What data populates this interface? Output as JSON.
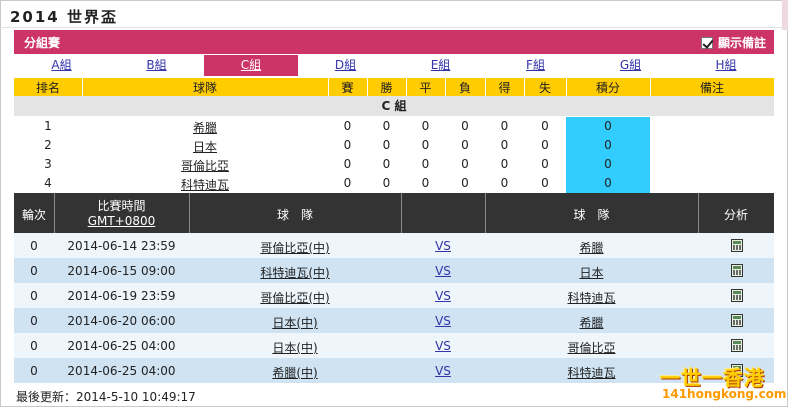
{
  "page_title": "2014 世界盃",
  "group_bar": {
    "label": "分組賽",
    "toggle_label": "顯示備註",
    "toggle_checked": true
  },
  "tabs": [
    "A組",
    "B組",
    "C組",
    "D組",
    "E組",
    "F組",
    "G組",
    "H組"
  ],
  "active_tab": "C組",
  "standings_header": {
    "rank": "排名",
    "team": "球隊",
    "played": "賽",
    "won": "勝",
    "draw": "平",
    "lost": "負",
    "gf": "得",
    "ga": "失",
    "points": "積分",
    "remarks": "備注"
  },
  "group_name": "C 組",
  "standings": [
    {
      "rank": "1",
      "team": "希臘",
      "played": "0",
      "won": "0",
      "draw": "0",
      "lost": "0",
      "gf": "0",
      "ga": "0",
      "points": "0"
    },
    {
      "rank": "2",
      "team": "日本",
      "played": "0",
      "won": "0",
      "draw": "0",
      "lost": "0",
      "gf": "0",
      "ga": "0",
      "points": "0"
    },
    {
      "rank": "3",
      "team": "哥倫比亞",
      "played": "0",
      "won": "0",
      "draw": "0",
      "lost": "0",
      "gf": "0",
      "ga": "0",
      "points": "0"
    },
    {
      "rank": "4",
      "team": "科特迪瓦",
      "played": "0",
      "won": "0",
      "draw": "0",
      "lost": "0",
      "gf": "0",
      "ga": "0",
      "points": "0"
    }
  ],
  "fixtures_header": {
    "round": "輪次",
    "time_line1": "比賽時間",
    "time_line2": "GMT+0800",
    "home": "球　隊",
    "away": "球　隊",
    "analysis": "分析"
  },
  "fixtures": [
    {
      "round": "0",
      "time": "2014-06-14 23:59",
      "home": "哥倫比亞(中)",
      "vs": "VS",
      "away": "希臘"
    },
    {
      "round": "0",
      "time": "2014-06-15 09:00",
      "home": "科特迪瓦(中)",
      "vs": "VS",
      "away": "日本"
    },
    {
      "round": "0",
      "time": "2014-06-19 23:59",
      "home": "哥倫比亞(中)",
      "vs": "VS",
      "away": "科特迪瓦"
    },
    {
      "round": "0",
      "time": "2014-06-20 06:00",
      "home": "日本(中)",
      "vs": "VS",
      "away": "希臘"
    },
    {
      "round": "0",
      "time": "2014-06-25 04:00",
      "home": "日本(中)",
      "vs": "VS",
      "away": "哥倫比亞"
    },
    {
      "round": "0",
      "time": "2014-06-25 04:00",
      "home": "希臘(中)",
      "vs": "VS",
      "away": "科特迪瓦"
    }
  ],
  "last_updated": "最後更新：2014-5-10 10:49:17",
  "watermark": {
    "main": "一世一香港",
    "sub": "141hongkong.com"
  },
  "colors": {
    "accent": "#cc3366",
    "header_yellow": "#ffcc00",
    "points_cyan": "#33ccff",
    "fixture_header": "#333333",
    "row_light": "#eef5fb",
    "row_dark": "#cfe3f3"
  }
}
